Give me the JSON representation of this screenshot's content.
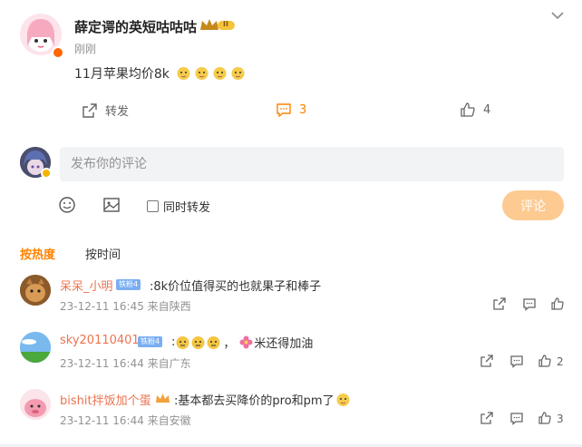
{
  "post": {
    "author": "薛定谔的英短咕咕咕",
    "level_badge": "II",
    "time": "刚刚",
    "text": "11月苹果均价8k"
  },
  "actions": {
    "repost": "转发",
    "comment_count": "3",
    "like_count": "4"
  },
  "composer": {
    "placeholder": "发布你的评论",
    "repost_label": "同时转发",
    "submit_label": "评论"
  },
  "sort": {
    "hot": "按热度",
    "time": "按时间"
  },
  "comments": [
    {
      "name": "呆呆_小明",
      "badge": "铁粉4",
      "text": ":8k价位值得买的也就果子和棒子",
      "meta": "23-12-11 16:45 来自陕西",
      "likes": ""
    },
    {
      "name": "sky20110401",
      "badge": "铁粉4",
      "text_a": ":",
      "text_b": "，",
      "text_c": "米还得加油",
      "meta": "23-12-11 16:44 来自广东",
      "likes": "2"
    },
    {
      "name": "bishit拌饭加个蛋",
      "text": ":基本都去买降价的pro和pm了",
      "meta": "23-12-11 16:44 来自安徽",
      "likes": "3"
    }
  ],
  "colors": {
    "accent": "#ff8200",
    "name": "#eb7350",
    "submit": "#fdcb92",
    "badge": "#7aaef3"
  }
}
